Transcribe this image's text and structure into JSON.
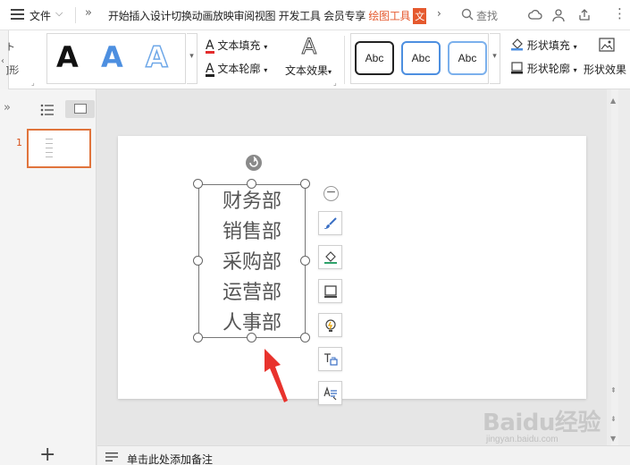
{
  "menubar": {
    "file_label": "文件",
    "tabs": [
      "开始",
      "插入",
      "设计",
      "切换",
      "动画",
      "放映",
      "审阅",
      "视图",
      "开发工具",
      "会员专享"
    ],
    "drawing_tools": "绘图工具",
    "text_tools_badge": "文",
    "search_label": "查找"
  },
  "ribbon": {
    "left_label_1": "ト",
    "left_label_2": "]形",
    "text_fill": "文本填充",
    "text_outline": "文本轮廓",
    "text_effect": "文本效果",
    "text_effect_glyph": "A",
    "wordart_glyph": "A",
    "shape_styles": [
      "Abc",
      "Abc",
      "Abc"
    ],
    "shape_fill": "形状填充",
    "shape_outline": "形状轮廓",
    "shape_effect": "形状效果"
  },
  "left_panel": {
    "slide_number": "1",
    "add_glyph": "+"
  },
  "slide": {
    "textbox_lines": [
      "财务部",
      "销售部",
      "采购部",
      "运营部",
      "人事部"
    ]
  },
  "notes": {
    "placeholder": "单击此处添加备注"
  },
  "watermark": {
    "brand": "Baidu经验",
    "url": "jingyan.baidu.com"
  },
  "colors": {
    "accent": "#e5592e",
    "wordart_blue": "#4d8fe0",
    "annotation_red": "#e8332d"
  }
}
